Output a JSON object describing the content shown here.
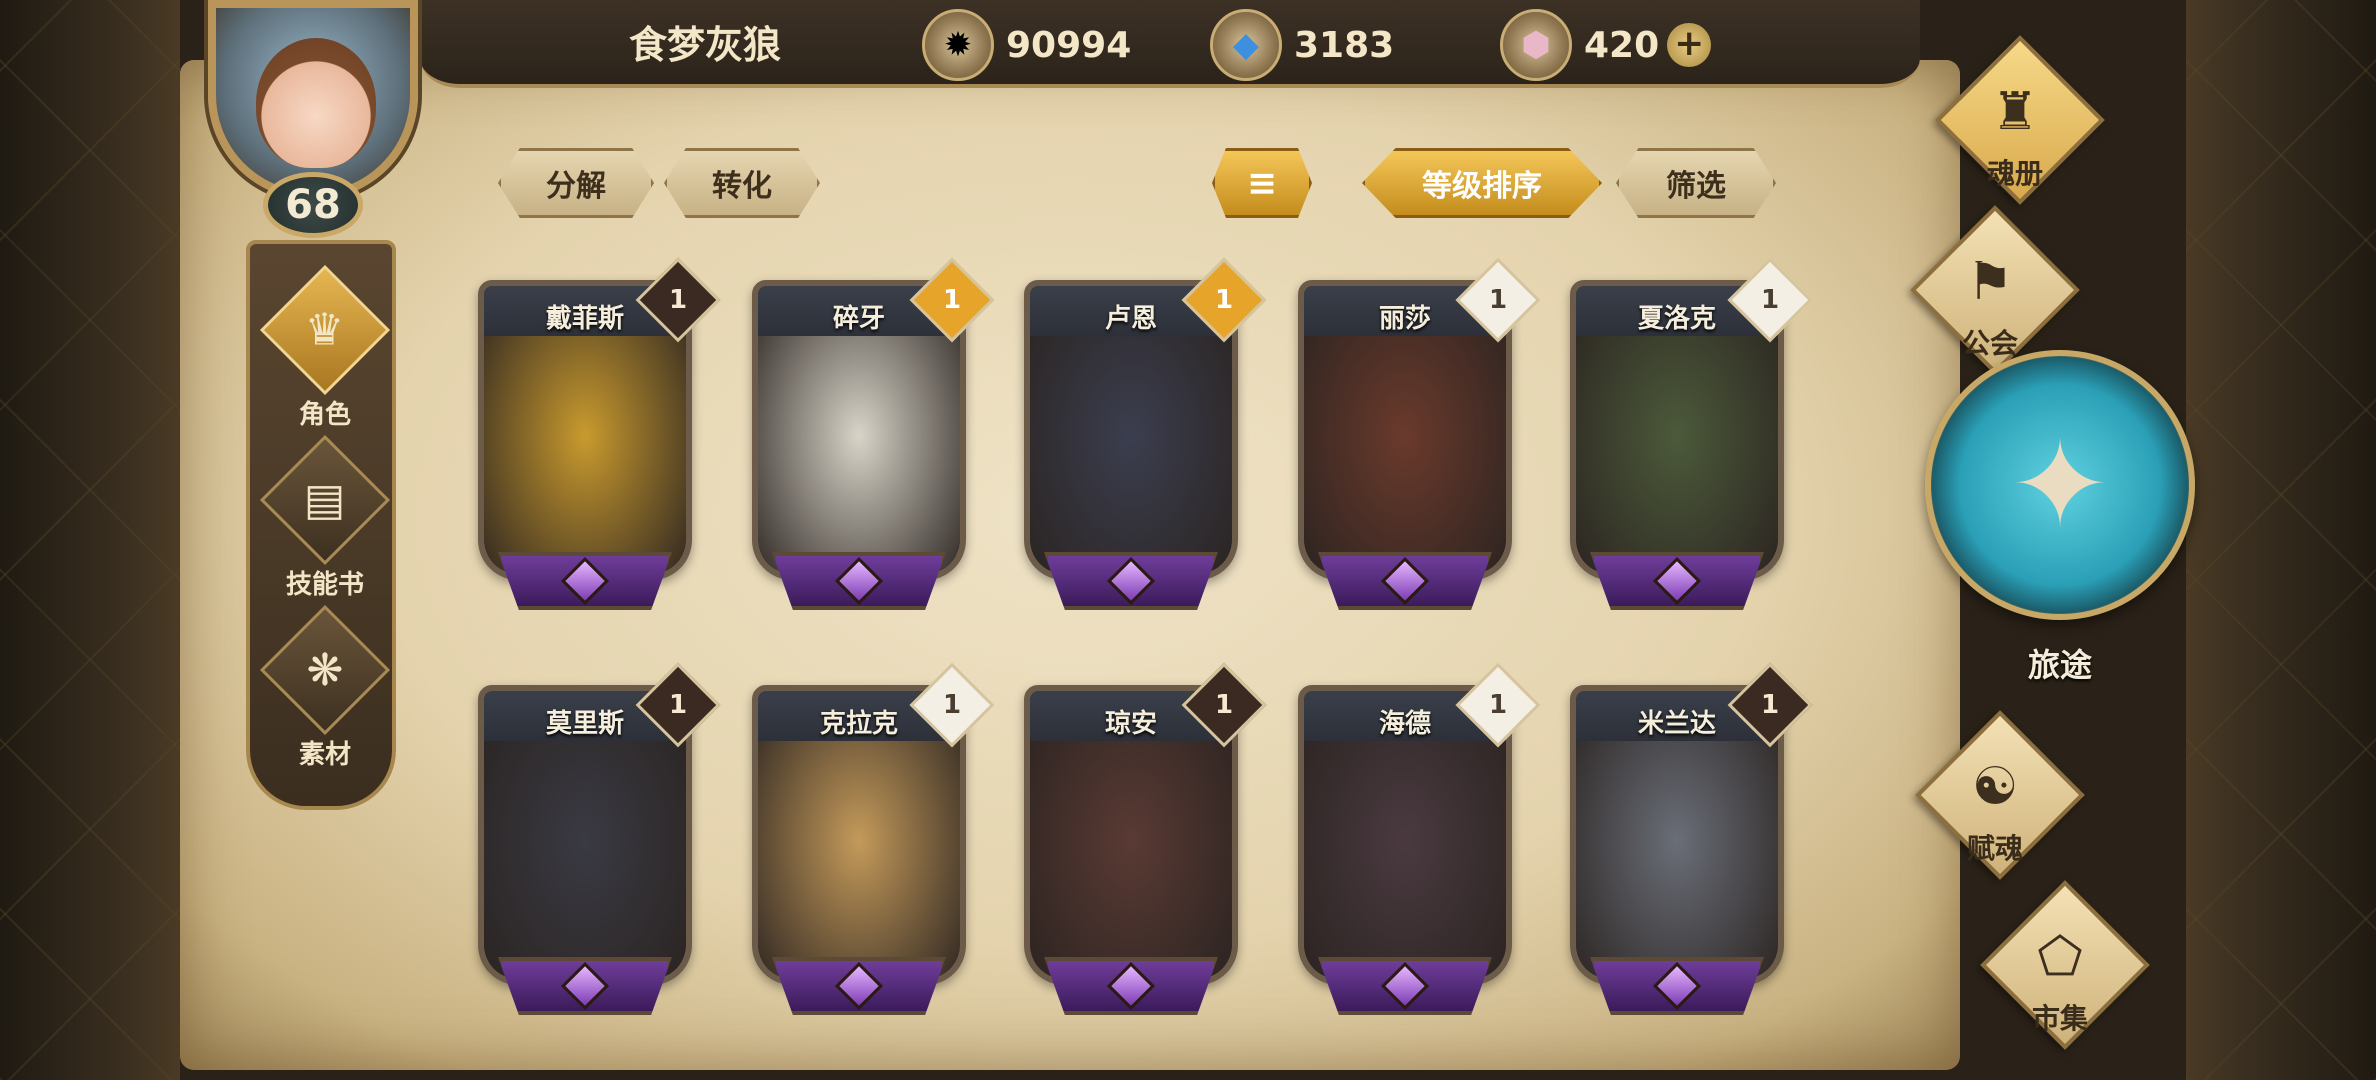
{
  "player": {
    "name": "食梦灰狼",
    "level": "68"
  },
  "currencies": [
    {
      "icon": "gold-coin-icon",
      "value": "90994"
    },
    {
      "icon": "blue-crystal-icon",
      "value": "3183"
    },
    {
      "icon": "pink-gem-icon",
      "value": "420"
    }
  ],
  "side_nav": [
    {
      "label": "角色",
      "icon": "character-icon",
      "active": true
    },
    {
      "label": "技能书",
      "icon": "skill-book-icon",
      "active": false
    },
    {
      "label": "素材",
      "icon": "material-icon",
      "active": false
    }
  ],
  "toolbar": {
    "decompose": "分解",
    "convert": "转化",
    "sort_order": "等级排序",
    "filter": "筛选"
  },
  "cards": [
    {
      "name": "戴菲斯",
      "stars": "1",
      "badge": "dark",
      "art": "#c99a2e"
    },
    {
      "name": "碎牙",
      "stars": "1",
      "badge": "gold",
      "art": "#d8d4c8"
    },
    {
      "name": "卢恩",
      "stars": "1",
      "badge": "gold",
      "art": "#3b3e4f"
    },
    {
      "name": "丽莎",
      "stars": "1",
      "badge": "white",
      "art": "#6a3a2c"
    },
    {
      "name": "夏洛克",
      "stars": "1",
      "badge": "white",
      "art": "#4c5a3a"
    },
    {
      "name": "莫里斯",
      "stars": "1",
      "badge": "dark",
      "art": "#3a3a44"
    },
    {
      "name": "克拉克",
      "stars": "1",
      "badge": "white",
      "art": "#c49a5a"
    },
    {
      "name": "琼安",
      "stars": "1",
      "badge": "dark",
      "art": "#5a3a34"
    },
    {
      "name": "海德",
      "stars": "1",
      "badge": "white",
      "art": "#4a3a40"
    },
    {
      "name": "米兰达",
      "stars": "1",
      "badge": "dark",
      "art": "#6a6e78"
    }
  ],
  "right_nav": [
    {
      "label": "魂册",
      "icon": "soul-book-icon",
      "active": true
    },
    {
      "label": "公会",
      "icon": "guild-icon",
      "active": false
    },
    {
      "label": "旅途",
      "icon": "journey-icon",
      "active": false
    },
    {
      "label": "赋魂",
      "icon": "soul-infuse-icon",
      "active": false
    },
    {
      "label": "市集",
      "icon": "market-icon",
      "active": false
    }
  ]
}
